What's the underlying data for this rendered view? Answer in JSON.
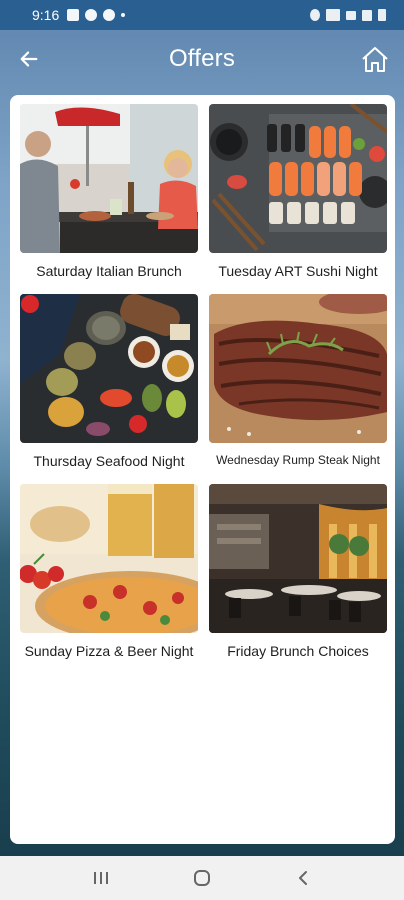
{
  "status_bar": {
    "time": "9:16"
  },
  "header": {
    "title": "Offers"
  },
  "offers": [
    {
      "label": "Saturday Italian Brunch"
    },
    {
      "label": "Tuesday ART Sushi Night"
    },
    {
      "label": "Thursday Seafood Night"
    },
    {
      "label": "Wednesday Rump Steak Night"
    },
    {
      "label": "Sunday Pizza & Beer Night"
    },
    {
      "label": "Friday Brunch Choices"
    }
  ],
  "colors": {
    "status_bar": "#2a5f92",
    "panel": "#ffffff",
    "nav_bar": "#f1f1f1"
  }
}
